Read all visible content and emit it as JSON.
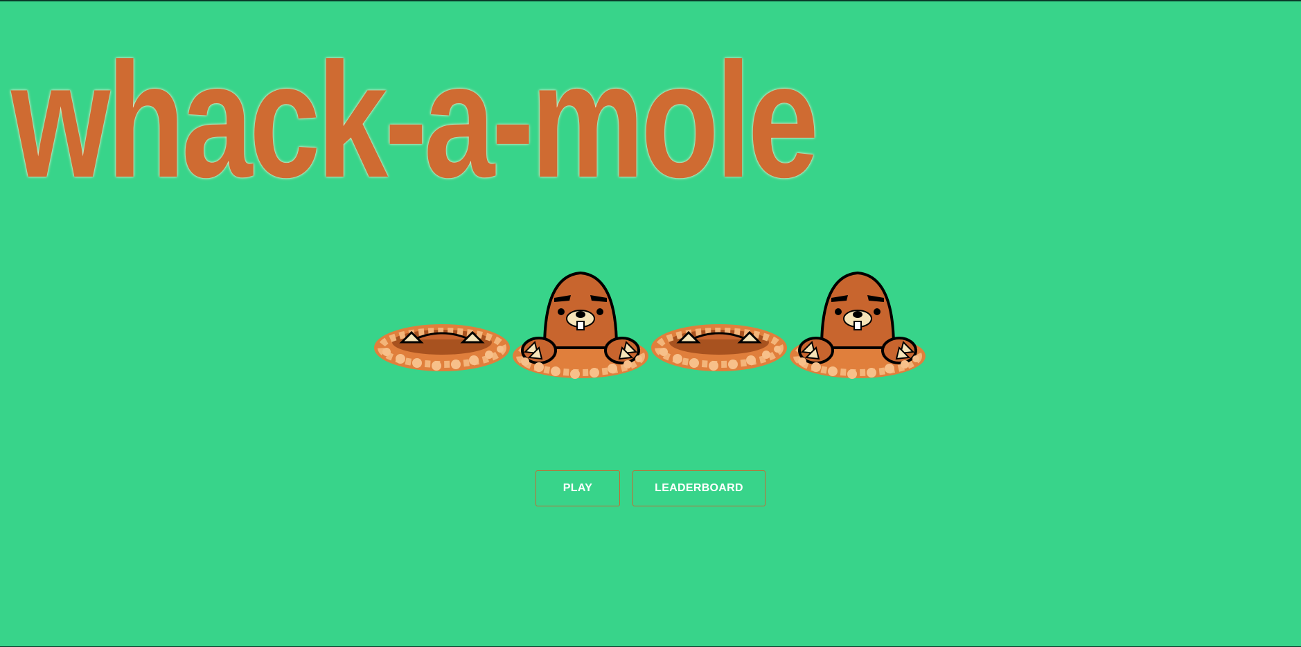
{
  "colors": {
    "background": "#38d48a",
    "title": "#cf6b32",
    "mole_body": "#c8652e",
    "dirt": "#e99a52",
    "button_border": "#c36a33",
    "button_text": "#ffffff"
  },
  "title": "whack-a-mole",
  "holes": [
    {
      "state": "hidden",
      "icon": "mole-claws-icon"
    },
    {
      "state": "visible",
      "icon": "mole-icon"
    },
    {
      "state": "hidden",
      "icon": "mole-claws-icon"
    },
    {
      "state": "visible",
      "icon": "mole-icon"
    }
  ],
  "buttons": {
    "play_label": "PLAY",
    "leaderboard_label": "LEADERBOARD"
  }
}
